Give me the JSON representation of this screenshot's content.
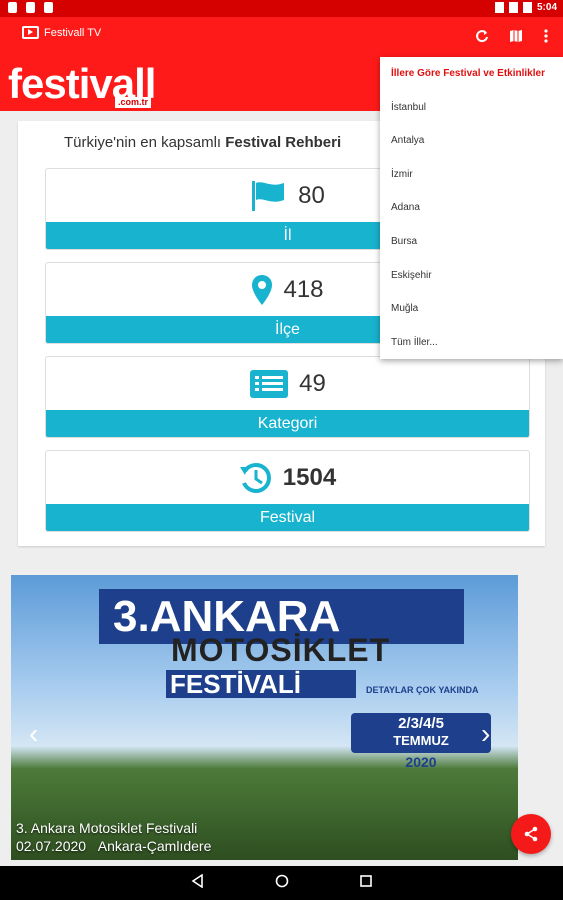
{
  "status_bar": {
    "time": "5:04"
  },
  "app_bar": {
    "title": "Festivall TV"
  },
  "logo": {
    "main": "festivall",
    "sub": ".com.tr"
  },
  "tagline": {
    "prefix": "Türkiye'nin en kapsamlı ",
    "bold": "Festival Rehberi"
  },
  "stats": [
    {
      "value": "80",
      "label": "İl",
      "icon": "flag-icon"
    },
    {
      "value": "418",
      "label": "İlçe",
      "icon": "location-pin-icon"
    },
    {
      "value": "49",
      "label": "Kategori",
      "icon": "list-icon"
    },
    {
      "value": "1504",
      "label": "Festival",
      "icon": "history-icon"
    }
  ],
  "slider": {
    "headline_1": "3.ANKARA",
    "headline_2": "MOTOSİKLET",
    "headline_3": "FESTİVALİ",
    "detail": "DETAYLAR ÇOK YAKINDA",
    "dates": "2/3/4/5",
    "month": "TEMMUZ",
    "year": "2020",
    "caption_title": "3. Ankara Motosiklet Festivali",
    "caption_date": "02.07.2020",
    "caption_location": "Ankara-Çamlıdere"
  },
  "menu": {
    "header": "İllere Göre Festival ve Etkinlikler",
    "items": [
      "İstanbul",
      "Antalya",
      "İzmir",
      "Adana",
      "Bursa",
      "Eskişehir",
      "Muğla",
      "Tüm İller..."
    ]
  },
  "colors": {
    "brand_red": "#ff1a1a",
    "accent_teal": "#17b3cf",
    "fab_red": "#f41a1a"
  }
}
